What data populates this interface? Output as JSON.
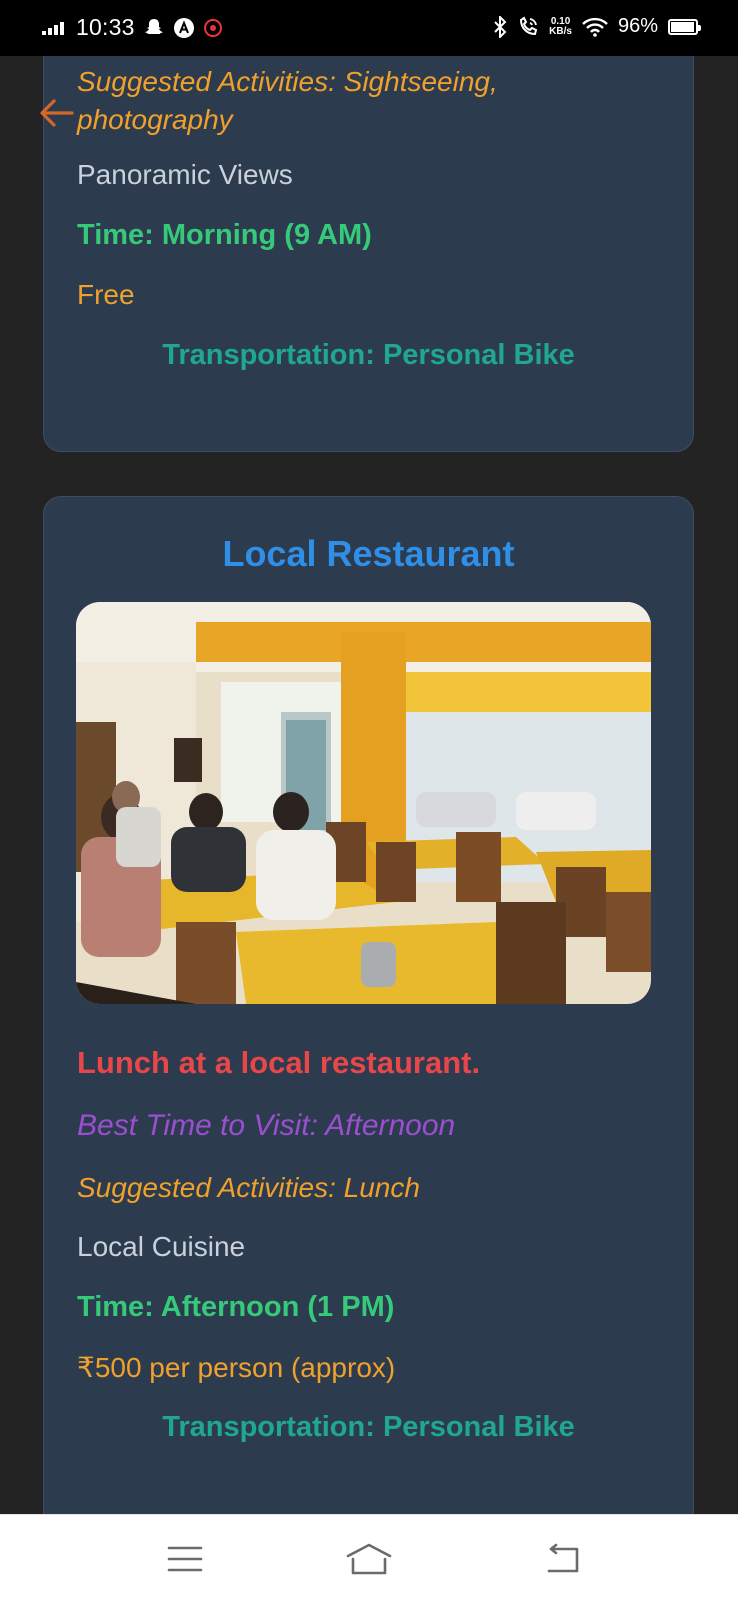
{
  "status_bar": {
    "time": "10:33",
    "net_speed_value": "0.10",
    "net_speed_unit": "KB/s",
    "battery_percent": "96%",
    "battery_level": 0.96
  },
  "cards": [
    {
      "suggested_activities": "Suggested Activities: Sightseeing, photography",
      "feature": "Panoramic Views",
      "time": "Time: Morning (9 AM)",
      "cost": "Free",
      "transportation": "Transportation: Personal Bike"
    },
    {
      "title": "Local Restaurant",
      "description": "Lunch at a local restaurant.",
      "best_time": "Best Time to Visit: Afternoon",
      "suggested_activities": "Suggested Activities: Lunch",
      "feature": "Local Cuisine",
      "time": "Time: Afternoon (1 PM)",
      "cost": "₹500 per person (approx)",
      "transportation": "Transportation: Personal Bike"
    }
  ],
  "icons": {
    "back": "back-arrow-icon",
    "nav_menu": "menu-icon",
    "nav_home": "home-icon",
    "nav_back": "back-icon"
  },
  "colors": {
    "background": "#232323",
    "card": "#2d3b4f",
    "title_blue": "#2f8fe6",
    "description_red": "#e8474a",
    "best_time_purple": "#9b4fd0",
    "activities_orange": "#f0a12b",
    "time_green": "#37c97a",
    "transport_teal": "#1fa88f"
  }
}
